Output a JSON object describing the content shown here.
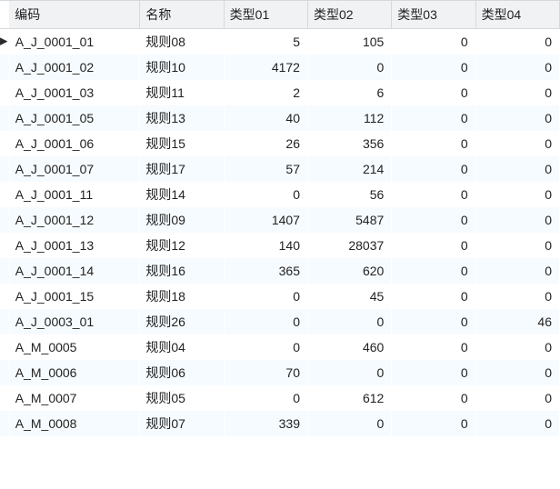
{
  "columns": {
    "code": "编码",
    "name": "名称",
    "type01": "类型01",
    "type02": "类型02",
    "type03": "类型03",
    "type04": "类型04"
  },
  "current_row_index": 0,
  "rows": [
    {
      "code": "A_J_0001_01",
      "name": "规则08",
      "type01": 5,
      "type02": 105,
      "type03": 0,
      "type04": 0
    },
    {
      "code": "A_J_0001_02",
      "name": "规则10",
      "type01": 4172,
      "type02": 0,
      "type03": 0,
      "type04": 0
    },
    {
      "code": "A_J_0001_03",
      "name": "规则11",
      "type01": 2,
      "type02": 6,
      "type03": 0,
      "type04": 0
    },
    {
      "code": "A_J_0001_05",
      "name": "规则13",
      "type01": 40,
      "type02": 112,
      "type03": 0,
      "type04": 0
    },
    {
      "code": "A_J_0001_06",
      "name": "规则15",
      "type01": 26,
      "type02": 356,
      "type03": 0,
      "type04": 0
    },
    {
      "code": "A_J_0001_07",
      "name": "规则17",
      "type01": 57,
      "type02": 214,
      "type03": 0,
      "type04": 0
    },
    {
      "code": "A_J_0001_11",
      "name": "规则14",
      "type01": 0,
      "type02": 56,
      "type03": 0,
      "type04": 0
    },
    {
      "code": "A_J_0001_12",
      "name": "规则09",
      "type01": 1407,
      "type02": 5487,
      "type03": 0,
      "type04": 0
    },
    {
      "code": "A_J_0001_13",
      "name": "规则12",
      "type01": 140,
      "type02": 28037,
      "type03": 0,
      "type04": 0
    },
    {
      "code": "A_J_0001_14",
      "name": "规则16",
      "type01": 365,
      "type02": 620,
      "type03": 0,
      "type04": 0
    },
    {
      "code": "A_J_0001_15",
      "name": "规则18",
      "type01": 0,
      "type02": 45,
      "type03": 0,
      "type04": 0
    },
    {
      "code": "A_J_0003_01",
      "name": "规则26",
      "type01": 0,
      "type02": 0,
      "type03": 0,
      "type04": 46
    },
    {
      "code": "A_M_0005",
      "name": "规则04",
      "type01": 0,
      "type02": 460,
      "type03": 0,
      "type04": 0
    },
    {
      "code": "A_M_0006",
      "name": "规则06",
      "type01": 70,
      "type02": 0,
      "type03": 0,
      "type04": 0
    },
    {
      "code": "A_M_0007",
      "name": "规则05",
      "type01": 0,
      "type02": 612,
      "type03": 0,
      "type04": 0
    },
    {
      "code": "A_M_0008",
      "name": "规则07",
      "type01": 339,
      "type02": 0,
      "type03": 0,
      "type04": 0
    }
  ]
}
